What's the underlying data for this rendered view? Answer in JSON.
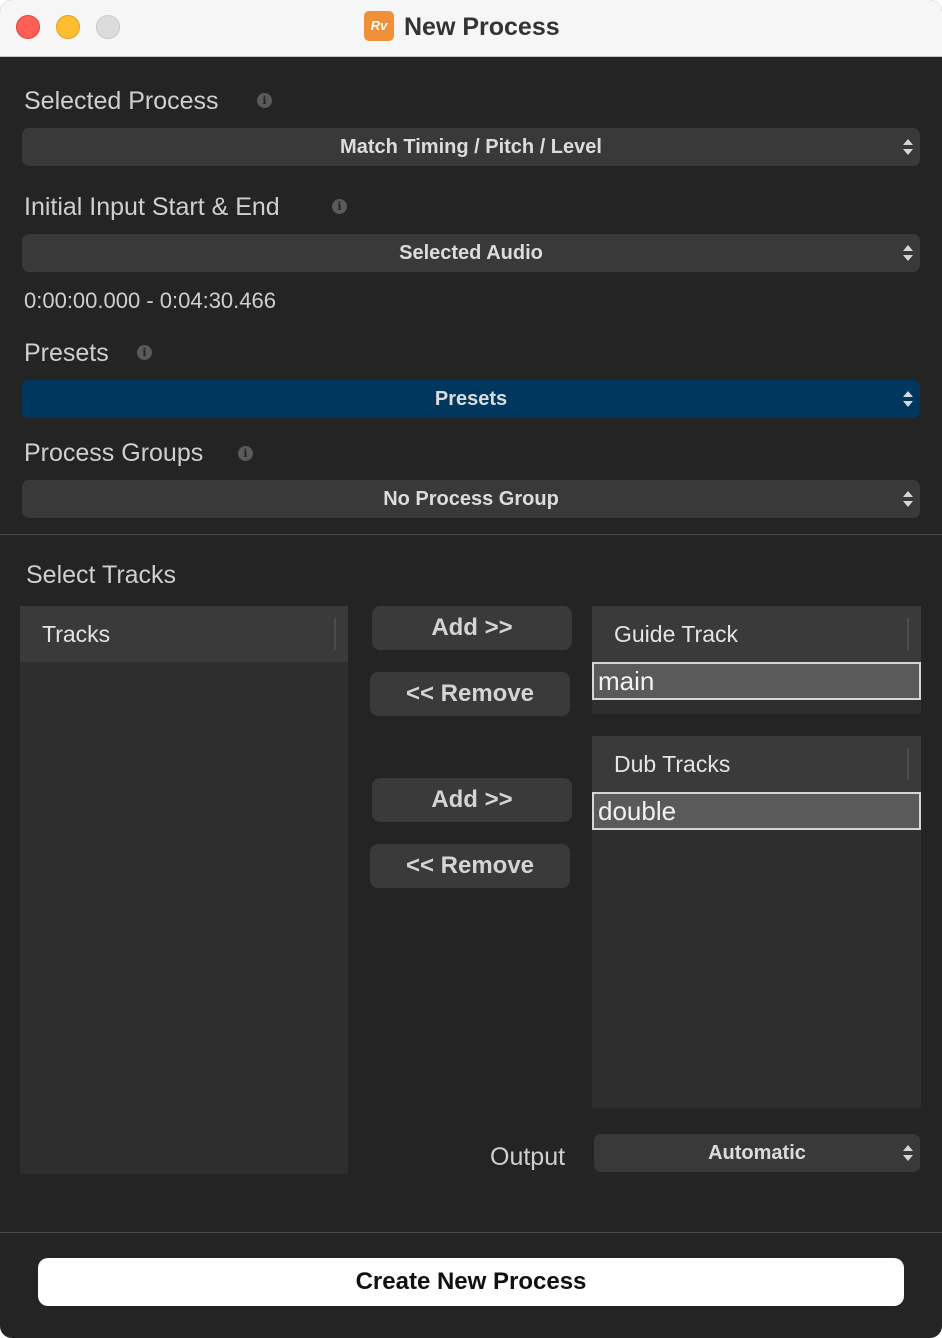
{
  "window": {
    "title": "New Process",
    "app_icon_text": "Rv"
  },
  "selected_process": {
    "label": "Selected Process",
    "value": "Match Timing / Pitch / Level"
  },
  "initial_input": {
    "label": "Initial Input Start & End",
    "value": "Selected Audio",
    "range": "0:00:00.000 - 0:04:30.466"
  },
  "presets": {
    "label": "Presets",
    "value": "Presets"
  },
  "process_groups": {
    "label": "Process Groups",
    "value": "No Process Group"
  },
  "select_tracks": {
    "label": "Select Tracks",
    "tracks_header": "Tracks",
    "add_label": "Add >>",
    "remove_label": "<< Remove",
    "guide_track": {
      "header": "Guide Track",
      "items": [
        "main"
      ]
    },
    "dub_tracks": {
      "header": "Dub Tracks",
      "items": [
        "double"
      ]
    }
  },
  "output": {
    "label": "Output",
    "value": "Automatic"
  },
  "create_button": "Create New Process",
  "colors": {
    "background": "#242424",
    "accent_blue": "#00375f"
  }
}
